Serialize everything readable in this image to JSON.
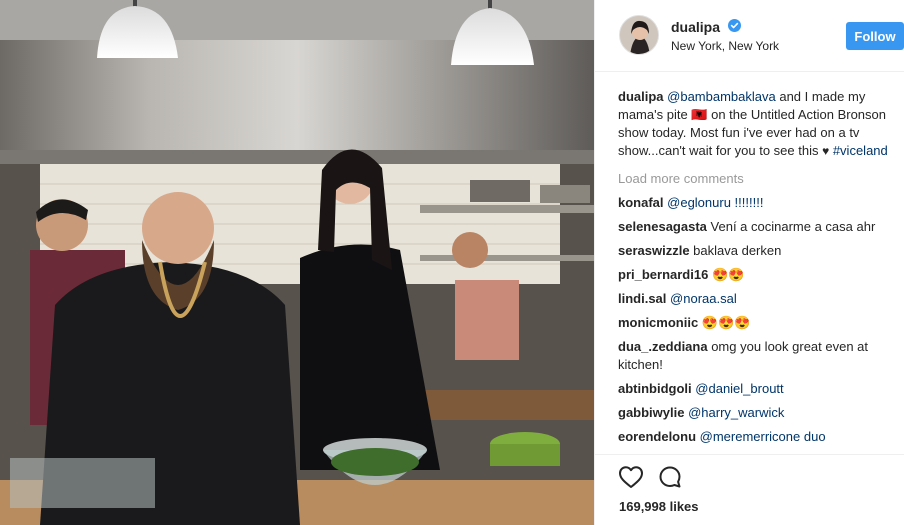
{
  "post": {
    "photo": {
      "alt": "Two people cooking in a restaurant kitchen"
    },
    "header": {
      "username": "dualipa",
      "location": "New York, New York",
      "follow_label": "Follow",
      "verified_icon": "verified-badge-icon",
      "accent_color": "#3897f0"
    },
    "caption": {
      "username": "dualipa",
      "mention": "@bambambaklava",
      "text_before": " and I made my mama's pite ",
      "flag_glyph": "🇦🇱",
      "text_after": " on the Untitled Action Bronson show today. Most fun i've ever had on a tv show...can't wait for you to see this ",
      "heart_glyph": "♥",
      "hashtag": " #viceland"
    },
    "load_more_label": "Load more comments",
    "comments": [
      {
        "username": "konafal",
        "text": "@eglonuru !!!!!!!!"
      },
      {
        "username": "selenesagasta",
        "text": "Vení a cocinarme a casa ahr"
      },
      {
        "username": "seraswizzle",
        "text": "baklava derken"
      },
      {
        "username": "pri_bernardi16",
        "text": "😍😍"
      },
      {
        "username": "lindi.sal",
        "text": "@noraa.sal"
      },
      {
        "username": "monicmoniic",
        "text": "😍😍😍"
      },
      {
        "username": "dua_.zeddiana",
        "text": "omg you look great even at kitchen!"
      },
      {
        "username": "abtinbidgoli",
        "text": "@daniel_broutt"
      },
      {
        "username": "gabbiwylie",
        "text": "@harry_warwick"
      },
      {
        "username": "eorendelonu",
        "text": "@meremerricone duo"
      }
    ],
    "actions": {
      "like_icon": "heart-outline-icon",
      "comment_icon": "comment-bubble-icon",
      "likes_text": "169,998 likes"
    }
  }
}
